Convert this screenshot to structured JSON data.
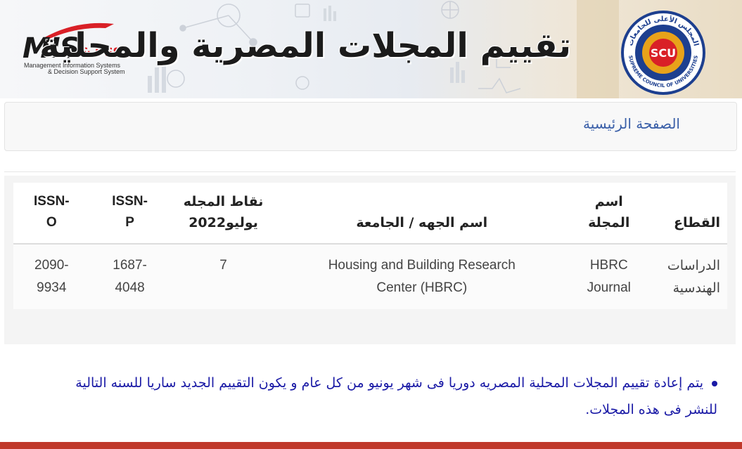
{
  "banner": {
    "title": "تقييم المجلات المصرية والمحلية",
    "left_logo": {
      "main": "MIS",
      "amp_dss": "& DSS",
      "line1": "Management Information Systems",
      "line2": "& Decision Support System"
    },
    "right_logo": {
      "seal_text": "SCU",
      "arabic_ring": "المجلس الأعلى للجامعات",
      "english_ring": "SUPREME COUNCIL OF UNIVERSITIES"
    }
  },
  "nav": {
    "home_label": "الصفحة الرئيسية"
  },
  "table": {
    "headers": {
      "sector": "القطاع",
      "journal_name": "اسم المجلة",
      "organization": "اسم الجهه / الجامعة",
      "points_line1": "نقاط المجله",
      "points_line2": "يوليو2022",
      "issn_p_line1": "ISSN-",
      "issn_p_line2": "P",
      "issn_o_line1": "ISSN-",
      "issn_o_line2": "O"
    },
    "rows": [
      {
        "sector_line1": "الدراسات",
        "sector_line2": "الهندسية",
        "name_line1": "HBRC",
        "name_line2": "Journal",
        "org_line1": "Housing and Building Research",
        "org_line2": "Center (HBRC)",
        "points": "7",
        "issn_p_line1": "1687-",
        "issn_p_line2": "4048",
        "issn_o_line1": "2090-",
        "issn_o_line2": "9934"
      }
    ]
  },
  "note": {
    "text": "يتم إعادة تقييم المجلات المحلية المصريه دوريا فى شهر يونيو من كل عام و يكون التقييم الجديد ساريا للسنه التالية للنشر فى هذه المجلات."
  },
  "colors": {
    "link": "#3a5fa8",
    "note_text": "#1a1aa6",
    "brand_red": "#d92027",
    "bottom_bar": "#c0392b"
  }
}
